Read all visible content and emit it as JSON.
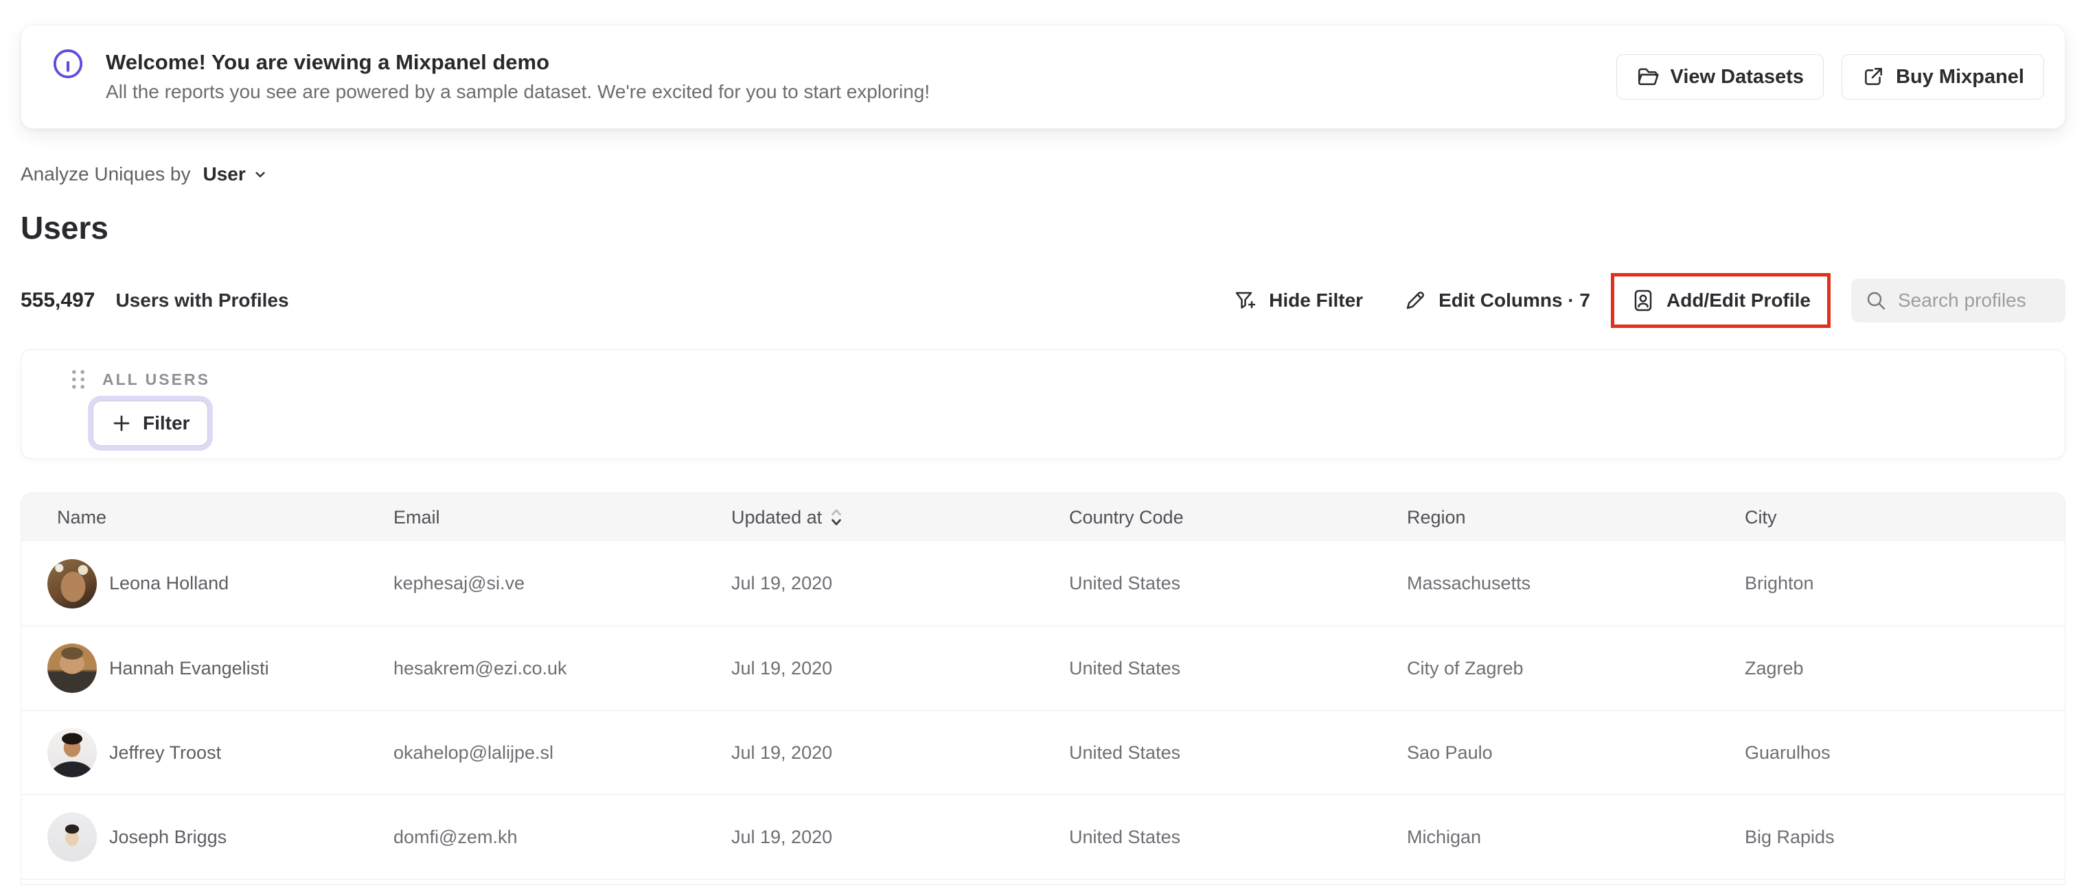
{
  "banner": {
    "title": "Welcome! You are viewing a Mixpanel demo",
    "subtitle": "All the reports you see are powered by a sample dataset. We're excited for you to start exploring!",
    "view_datasets_label": "View Datasets",
    "buy_mixpanel_label": "Buy Mixpanel"
  },
  "controls": {
    "analyze_label": "Analyze Uniques by",
    "analyze_value": "User"
  },
  "page": {
    "title": "Users"
  },
  "stats": {
    "count": "555,497",
    "label": "Users with Profiles"
  },
  "toolbar": {
    "hide_filter_label": "Hide Filter",
    "edit_columns_label": "Edit Columns · 7",
    "add_edit_profile_label": "Add/Edit Profile",
    "search_placeholder": "Search profiles"
  },
  "filter_panel": {
    "group_label": "ALL USERS",
    "add_filter_label": "Filter"
  },
  "table": {
    "columns": [
      "Name",
      "Email",
      "Updated at",
      "Country Code",
      "Region",
      "City"
    ],
    "rows": [
      {
        "name": "Leona Holland",
        "email": "kephesaj@si.ve",
        "updated_at": "Jul 19, 2020",
        "country_code": "United States",
        "region": "Massachusetts",
        "city": "Brighton"
      },
      {
        "name": "Hannah Evangelisti",
        "email": "hesakrem@ezi.co.uk",
        "updated_at": "Jul 19, 2020",
        "country_code": "United States",
        "region": "City of Zagreb",
        "city": "Zagreb"
      },
      {
        "name": "Jeffrey Troost",
        "email": "okahelop@lalijpe.sl",
        "updated_at": "Jul 19, 2020",
        "country_code": "United States",
        "region": "Sao Paulo",
        "city": "Guarulhos"
      },
      {
        "name": "Joseph Briggs",
        "email": "domfi@zem.kh",
        "updated_at": "Jul 19, 2020",
        "country_code": "United States",
        "region": "Michigan",
        "city": "Big Rapids"
      }
    ]
  },
  "colors": {
    "accent_purple": "#5a4fdf",
    "highlight_red": "#e1301c"
  }
}
